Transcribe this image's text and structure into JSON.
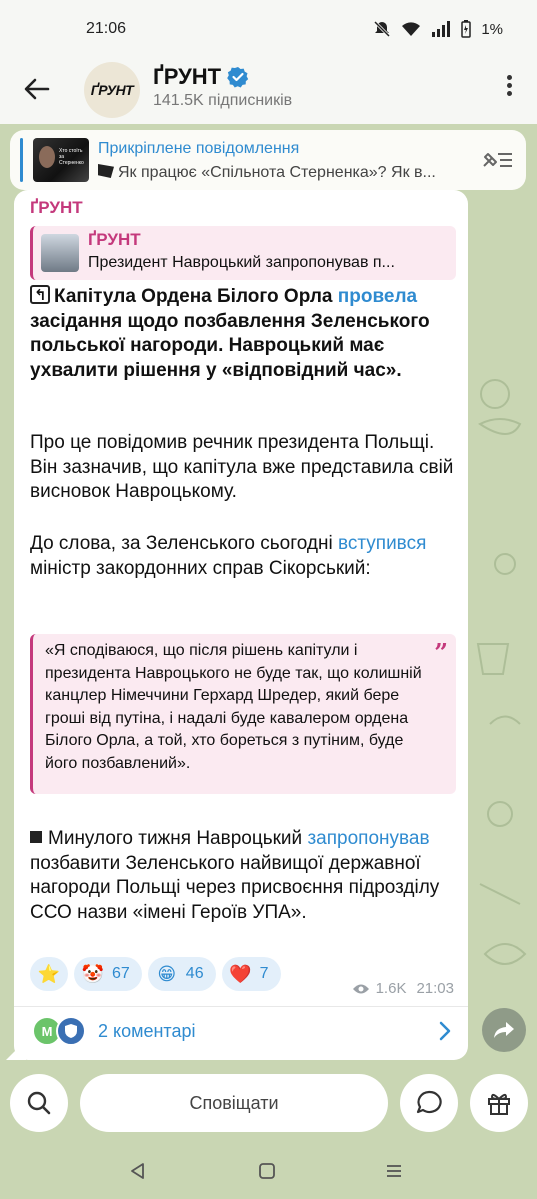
{
  "status_bar": {
    "time": "21:06",
    "battery": "1%"
  },
  "header": {
    "channel_name": "ҐРУНТ",
    "avatar_text": "ҐРУНТ",
    "subscribers": "141.5K підписників"
  },
  "pinned": {
    "title": "Прикріплене повідомлення",
    "text": "Як працює «Спільнота Стерненка»? Як в...",
    "thumb_text": "Хто стоїть за Стерненко"
  },
  "message": {
    "sender": "ҐРУНТ",
    "reply": {
      "name": "ҐРУНТ",
      "text": "Президент Навроцький запропонував п..."
    },
    "p1_bold_a": "Капітула Ордена Білого Орла ",
    "p1_link": "провела",
    "p1_bold_b": " засідання щодо позбавлення Зеленського польської нагороди. Навроцький має ухвалити рішення у «відповідний час».",
    "p2": "Про це повідомив речник президента Польщі. Він зазначив, що капітула вже представила свій висновок Навроцькому.",
    "p3_a": "До слова, за Зеленського сьогодні ",
    "p3_link": "вступився",
    "p3_b": " міністр закордонних справ Сікорський:",
    "quote": "«Я сподіваюся, що після рішень капітули і президента Навроцького не буде так, що колишній канцлер Німеччини Герхард Шредер, який бере гроші від путіна, і надалі буде кавалером ордена Білого Орла, а той, хто бореться з путіним, буде його позбавлений».",
    "p4_a": "Минулого тижня Навроцький ",
    "p4_link": "запропонував",
    "p4_b": " позбавити Зеленського найвищої державної нагороди Польщі через присвоєння підрозділу ССО назви «імені Героїв УПА».",
    "reactions": [
      {
        "emoji": "⭐",
        "count": ""
      },
      {
        "emoji": "🤡",
        "count": "67"
      },
      {
        "emoji": "😁",
        "count": "46"
      },
      {
        "emoji": "❤️",
        "count": "7"
      }
    ],
    "views": "1.6K",
    "time": "21:03",
    "comments_label": "2 коментарі",
    "comment_avatar_letter": "M"
  },
  "bottom": {
    "notify_label": "Сповіщати"
  },
  "colors": {
    "accent": "#2f8bd0",
    "sender": "#c4397c",
    "chat_bg": "#c9d6b3"
  }
}
